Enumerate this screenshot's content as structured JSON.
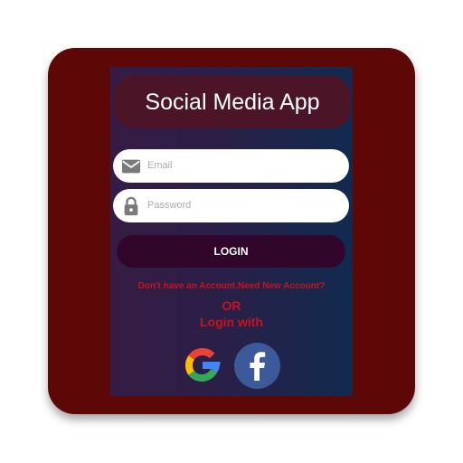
{
  "app": {
    "title": "Social Media App"
  },
  "form": {
    "email_placeholder": "Email",
    "password_placeholder": "Password",
    "login_label": "LOGIN"
  },
  "links": {
    "signup": "Don't have an Account.Need New Account?",
    "or": "OR",
    "login_with": "Login with"
  },
  "social": [
    {
      "name": "google",
      "icon": "google-icon"
    },
    {
      "name": "facebook",
      "icon": "facebook-icon"
    }
  ],
  "colors": {
    "icon_background": "#5e0707",
    "title_card": "#4c1427",
    "login_button": "#31062b",
    "link_text": "#c8131c",
    "facebook_blue": "#3c5a9a"
  }
}
